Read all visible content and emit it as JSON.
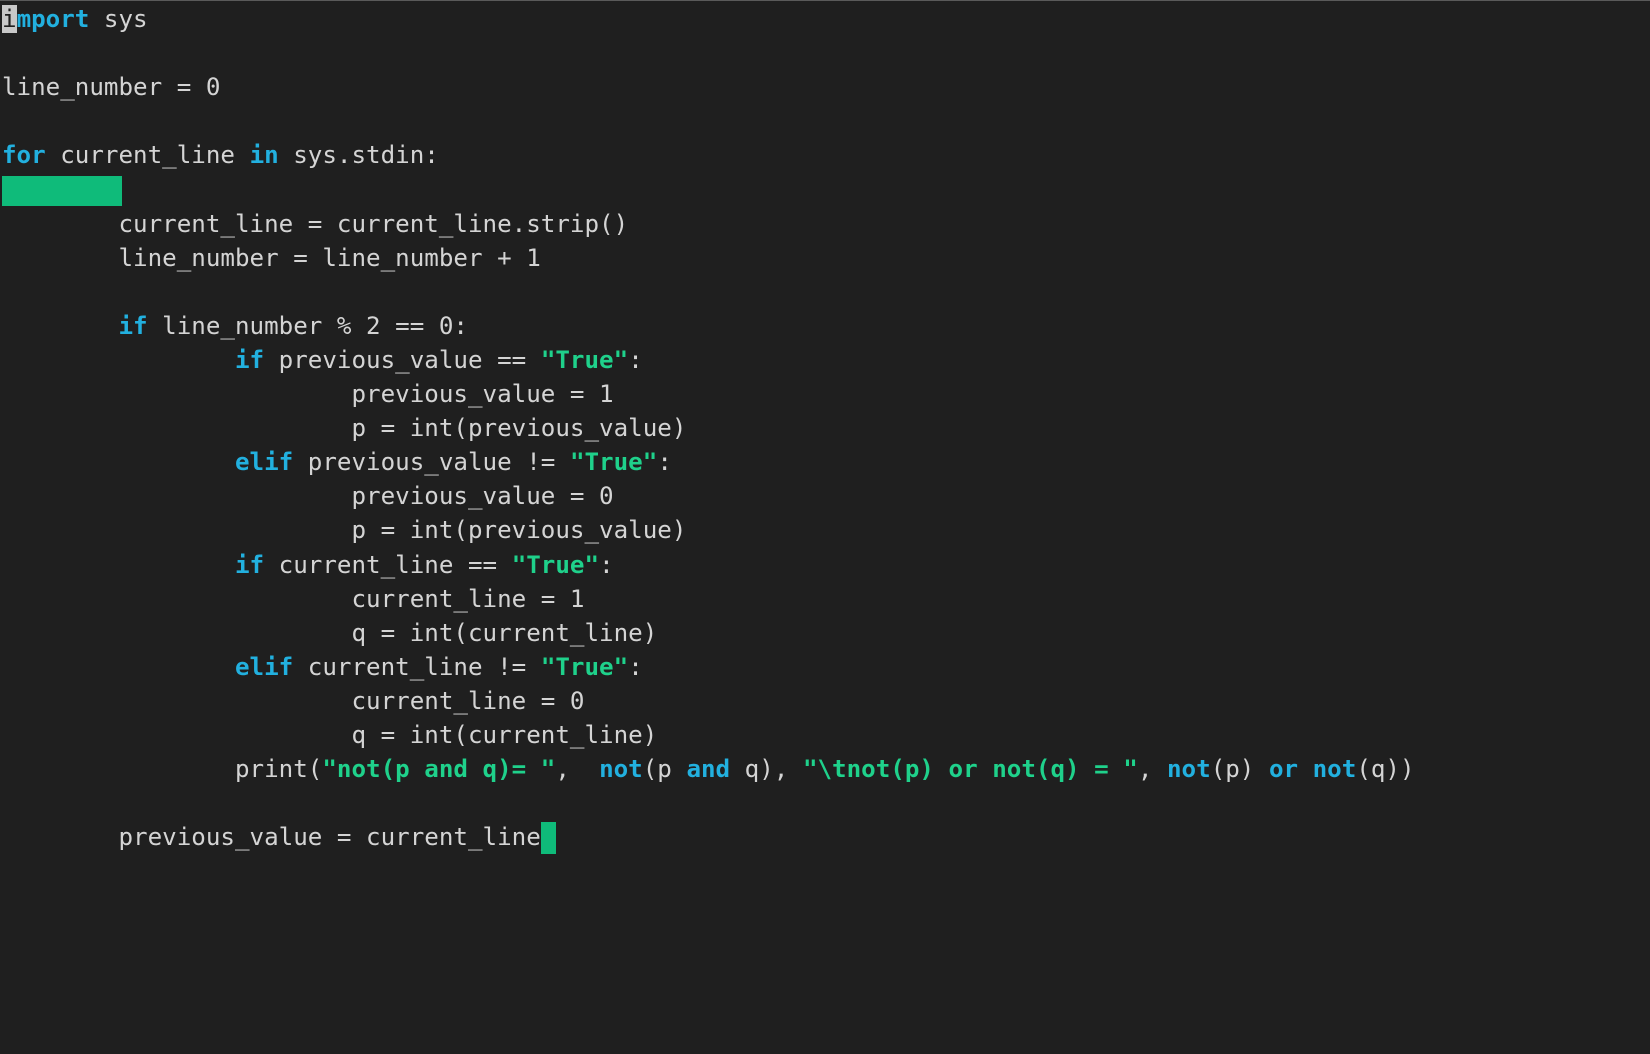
{
  "editor": {
    "language": "python",
    "cursor_color": "#0fbb7a",
    "lines": [
      [
        {
          "t": "i",
          "c": "cursor-top"
        },
        {
          "t": "mport",
          "c": "kw"
        },
        {
          "t": " sys"
        }
      ],
      [],
      [
        {
          "t": "line_number = 0"
        }
      ],
      [],
      [
        {
          "t": "for",
          "c": "kw"
        },
        {
          "t": " current_line "
        },
        {
          "t": "in",
          "c": "kw"
        },
        {
          "t": " sys.stdin:"
        }
      ],
      [
        {
          "t": "",
          "c": "indent-block"
        }
      ],
      [
        {
          "t": "        current_line = current_line.strip()"
        }
      ],
      [
        {
          "t": "        line_number = line_number + 1"
        }
      ],
      [],
      [
        {
          "t": "        "
        },
        {
          "t": "if",
          "c": "kw"
        },
        {
          "t": " line_number % 2 == 0:"
        }
      ],
      [
        {
          "t": "                "
        },
        {
          "t": "if",
          "c": "kw"
        },
        {
          "t": " previous_value == "
        },
        {
          "t": "\"True\"",
          "c": "str"
        },
        {
          "t": ":"
        }
      ],
      [
        {
          "t": "                        previous_value = 1"
        }
      ],
      [
        {
          "t": "                        p = int(previous_value)"
        }
      ],
      [
        {
          "t": "                "
        },
        {
          "t": "elif",
          "c": "kw"
        },
        {
          "t": " previous_value != "
        },
        {
          "t": "\"True\"",
          "c": "str"
        },
        {
          "t": ":"
        }
      ],
      [
        {
          "t": "                        previous_value = 0"
        }
      ],
      [
        {
          "t": "                        p = int(previous_value)"
        }
      ],
      [
        {
          "t": "                "
        },
        {
          "t": "if",
          "c": "kw"
        },
        {
          "t": " current_line == "
        },
        {
          "t": "\"True\"",
          "c": "str"
        },
        {
          "t": ":"
        }
      ],
      [
        {
          "t": "                        current_line = 1"
        }
      ],
      [
        {
          "t": "                        q = int(current_line)"
        }
      ],
      [
        {
          "t": "                "
        },
        {
          "t": "elif",
          "c": "kw"
        },
        {
          "t": " current_line != "
        },
        {
          "t": "\"True\"",
          "c": "str"
        },
        {
          "t": ":"
        }
      ],
      [
        {
          "t": "                        current_line = 0"
        }
      ],
      [
        {
          "t": "                        q = int(current_line)"
        }
      ],
      [
        {
          "t": "                print("
        },
        {
          "t": "\"not(p and q)= \"",
          "c": "str"
        },
        {
          "t": ",  "
        },
        {
          "t": "not",
          "c": "kw"
        },
        {
          "t": "(p "
        },
        {
          "t": "and",
          "c": "kw"
        },
        {
          "t": " q), "
        },
        {
          "t": "\"\\tnot(p) or not(q) = \"",
          "c": "str"
        },
        {
          "t": ", "
        },
        {
          "t": "not",
          "c": "kw"
        },
        {
          "t": "(p) "
        },
        {
          "t": "or",
          "c": "kw"
        },
        {
          "t": " "
        },
        {
          "t": "not",
          "c": "kw"
        },
        {
          "t": "(q))"
        }
      ],
      [],
      [
        {
          "t": "        previous_value = current_line"
        },
        {
          "t": "",
          "c": "cursor-end"
        }
      ]
    ]
  }
}
